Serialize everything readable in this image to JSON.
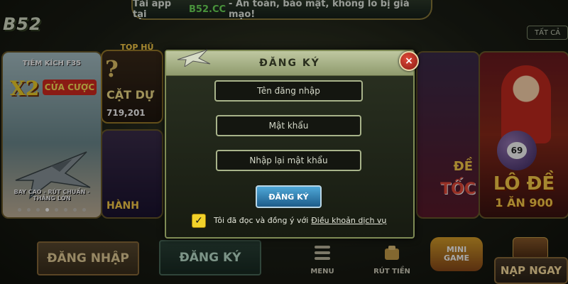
{
  "top_banner": {
    "prefix": "Tải app tại",
    "brand": "B52.CC",
    "suffix": "- An toàn, bảo mật, không lo bị giả mạo!"
  },
  "logo": {
    "text": "B52"
  },
  "filter": {
    "label": "TẤT CẢ"
  },
  "cards": {
    "f35": {
      "title": "TIÊM KÍCH F35",
      "x2": "X2",
      "badge": "CỬA CƯỢC",
      "footer": "BAY CAO - RÚT CHUẨN - THẮNG LỚN"
    },
    "tophu": {
      "label": "TOP HŨ",
      "question": "?",
      "text": "CẶT DỰ",
      "number": "719,201"
    },
    "hanh": {
      "text": "HÀNH"
    },
    "de": {
      "text": "ĐỀ",
      "text2": "TỐC"
    },
    "lode": {
      "ball": "69",
      "title": "LÔ ĐỀ",
      "subtitle": "1 ĂN 900"
    }
  },
  "modal": {
    "title": "ĐĂNG KÝ",
    "close_icon": "×",
    "username_placeholder": "Tên đăng nhập",
    "password_placeholder": "Mật khẩu",
    "confirm_placeholder": "Nhập lại mật khẩu",
    "submit_label": "ĐĂNG KÝ",
    "agree_text": "Tôi đã đọc và đồng ý với",
    "terms_link": "Điều khoản dịch vụ",
    "checkbox_mark": "✓"
  },
  "bottom": {
    "login_label": "ĐĂNG NHẬP",
    "register_label": "ĐĂNG KÝ",
    "menu_label": "MENU",
    "withdraw_label": "RÚT TIỀN",
    "mini_line1": "MINI",
    "mini_line2": "GAME",
    "topup_label": "NẠP NGAY"
  },
  "colors": {
    "accent_green": "#6fe05b",
    "gold": "#ffd24a",
    "modal_header": "#bfc8a1"
  }
}
